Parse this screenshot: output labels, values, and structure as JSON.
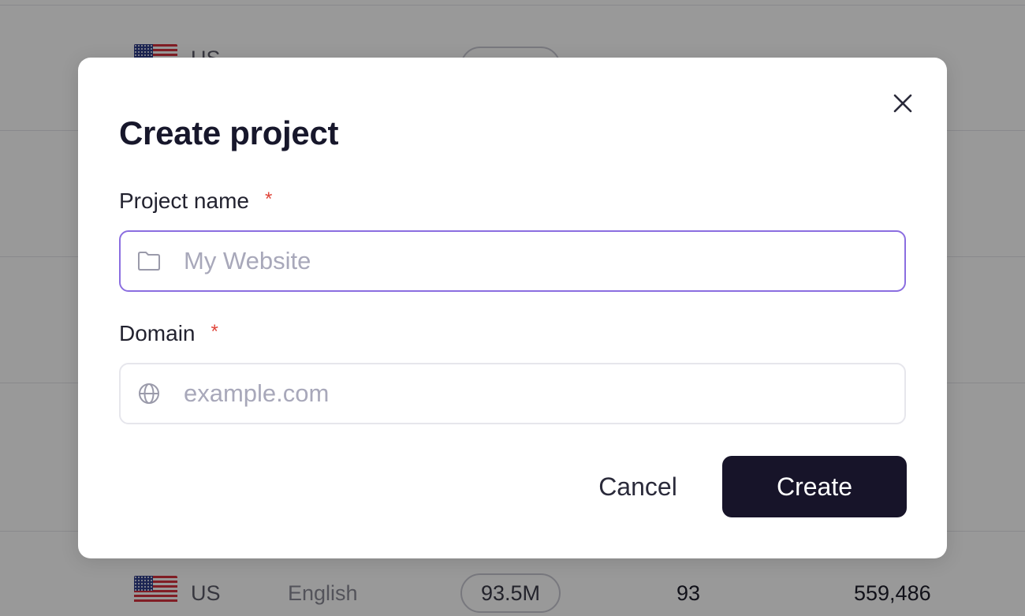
{
  "modal": {
    "title": "Create project",
    "close_icon": "close-icon",
    "fields": {
      "project_name": {
        "label": "Project name",
        "required_mark": "*",
        "placeholder": "My Website",
        "value": "",
        "icon": "folder-icon"
      },
      "domain": {
        "label": "Domain",
        "required_mark": "*",
        "placeholder": "example.com",
        "value": "",
        "icon": "globe-icon"
      }
    },
    "buttons": {
      "cancel_label": "Cancel",
      "create_label": "Create"
    }
  },
  "background_table": {
    "rows": [
      {
        "country": "US",
        "language": "",
        "volume": "",
        "score": "",
        "traffic": ""
      },
      {
        "country": "US",
        "language": "English",
        "volume": "93.5M",
        "score": "93",
        "traffic": "559,486"
      }
    ]
  },
  "colors": {
    "accent_focus": "#8b6ee0",
    "primary_button": "#171429",
    "required": "#e0453a"
  }
}
